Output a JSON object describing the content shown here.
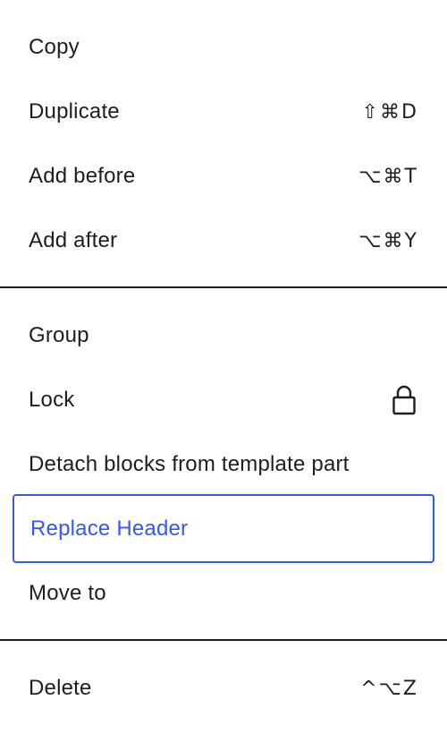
{
  "menu": {
    "group1": {
      "copy": {
        "label": "Copy"
      },
      "duplicate": {
        "label": "Duplicate",
        "shortcut": "⇧⌘D"
      },
      "add_before": {
        "label": "Add before",
        "shortcut": "⌥⌘T"
      },
      "add_after": {
        "label": "Add after",
        "shortcut": "⌥⌘Y"
      }
    },
    "group2": {
      "group": {
        "label": "Group"
      },
      "lock": {
        "label": "Lock",
        "icon": "lock-icon"
      },
      "detach": {
        "label": "Detach blocks from template part"
      },
      "replace": {
        "label": "Replace Header"
      },
      "move_to": {
        "label": "Move to"
      }
    },
    "group3": {
      "delete": {
        "label": "Delete",
        "shortcut": "^⌥Z"
      }
    }
  },
  "colors": {
    "text": "#1e1e1e",
    "accent": "#3858e9",
    "background": "#ffffff",
    "divider": "#1e1e1e"
  }
}
